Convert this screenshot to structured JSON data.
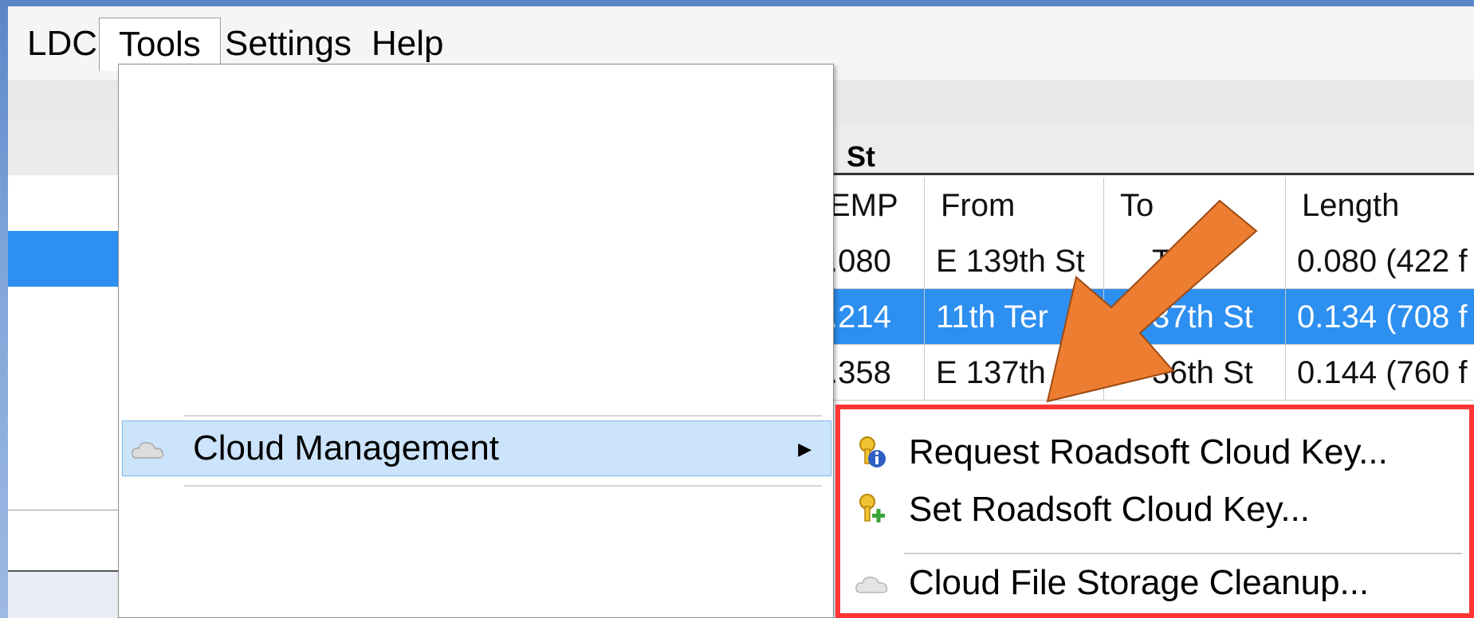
{
  "menubar": {
    "items": [
      {
        "label": "LDC"
      },
      {
        "label": "Tools"
      },
      {
        "label": "Settings"
      },
      {
        "label": "Help"
      }
    ]
  },
  "grid": {
    "title": "St",
    "headers": [
      "EMP",
      "From",
      "To",
      "Length"
    ],
    "rows": [
      {
        "emp": ".080",
        "from": "E 139th St",
        "to": "Ter",
        "length": "0.080 (422 f",
        "selected": false
      },
      {
        "emp": ".214",
        "from": "11th Ter",
        "to": "37th St",
        "length": "0.134 (708 f",
        "selected": true
      },
      {
        "emp": ".358",
        "from": "E 137th S",
        "to": "36th St",
        "length": "0.144 (760 f",
        "selected": false
      }
    ]
  },
  "tools_menu": {
    "highlighted_item": {
      "label": "Cloud Management",
      "icon": "cloud-icon"
    }
  },
  "submenu": {
    "items": [
      {
        "label": "Request Roadsoft Cloud Key...",
        "icon": "key-info-icon"
      },
      {
        "label": "Set Roadsoft Cloud Key...",
        "icon": "key-add-icon"
      },
      {
        "label": "Cloud File Storage Cleanup...",
        "icon": "cloud-icon"
      }
    ],
    "highlight_color": "#ff3535"
  },
  "colors": {
    "selection_blue": "#2d8ff0",
    "menu_highlight": "#cce4fb",
    "annotation_arrow": "#ed7d31"
  }
}
